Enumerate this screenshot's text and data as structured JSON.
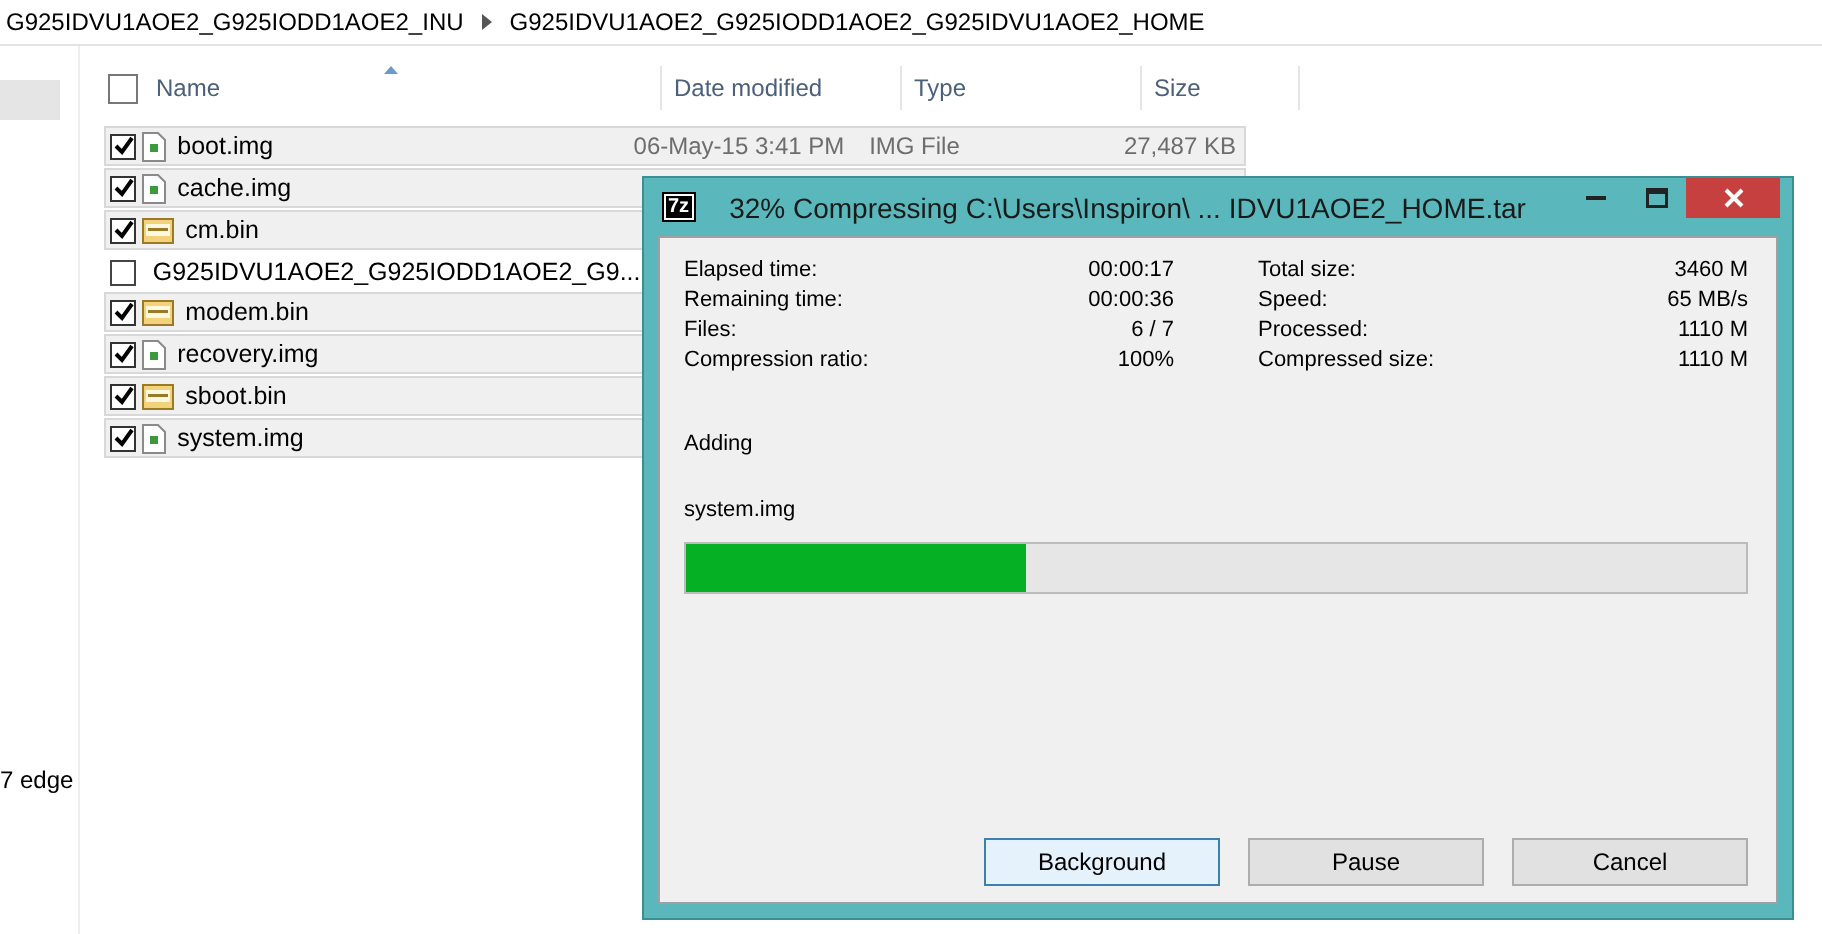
{
  "breadcrumb": [
    "G925IDVU1AOE2_G925IODD1AOE2_INU",
    "G925IDVU1AOE2_G925IODD1AOE2_G925IDVU1AOE2_HOME"
  ],
  "sidebar": {
    "items": [
      {
        "selected": true
      },
      {
        "label": "7 edge",
        "selected": false
      }
    ]
  },
  "file_list": {
    "select_all_checked": false,
    "columns": [
      "Name",
      "Date modified",
      "Type",
      "Size"
    ],
    "rows": [
      {
        "name": "boot.img",
        "kind": "img",
        "checked": true,
        "date": "06-May-15 3:41 PM",
        "type": "IMG File",
        "size": "27,487 KB"
      },
      {
        "name": "cache.img",
        "kind": "img",
        "checked": true
      },
      {
        "name": "cm.bin",
        "kind": "bin",
        "checked": true
      },
      {
        "name": "G925IDVU1AOE2_G925IODD1AOE2_G9...",
        "kind": "file",
        "checked": false
      },
      {
        "name": "modem.bin",
        "kind": "bin",
        "checked": true
      },
      {
        "name": "recovery.img",
        "kind": "img",
        "checked": true
      },
      {
        "name": "sboot.bin",
        "kind": "bin",
        "checked": true
      },
      {
        "name": "system.img",
        "kind": "img",
        "checked": true
      }
    ]
  },
  "dialog": {
    "app_icon": "7z",
    "title": "32% Compressing C:\\Users\\Inspiron\\ ... IDVU1AOE2_HOME.tar",
    "stats_left": [
      {
        "label": "Elapsed time:",
        "value": "00:00:17"
      },
      {
        "label": "Remaining time:",
        "value": "00:00:36"
      },
      {
        "label": "Files:",
        "value": "6 / 7"
      },
      {
        "label": "Compression ratio:",
        "value": "100%"
      }
    ],
    "stats_right": [
      {
        "label": "Total size:",
        "value": "3460 M"
      },
      {
        "label": "Speed:",
        "value": "65 MB/s"
      },
      {
        "label": "Processed:",
        "value": "1110 M"
      },
      {
        "label": "Compressed size:",
        "value": "1110 M"
      }
    ],
    "action": "Adding",
    "current_file": "system.img",
    "progress": {
      "level": 0.32
    },
    "buttons": [
      {
        "label": "Background",
        "selected": true
      },
      {
        "label": "Pause",
        "selected": false
      },
      {
        "label": "Cancel",
        "selected": false
      }
    ]
  }
}
